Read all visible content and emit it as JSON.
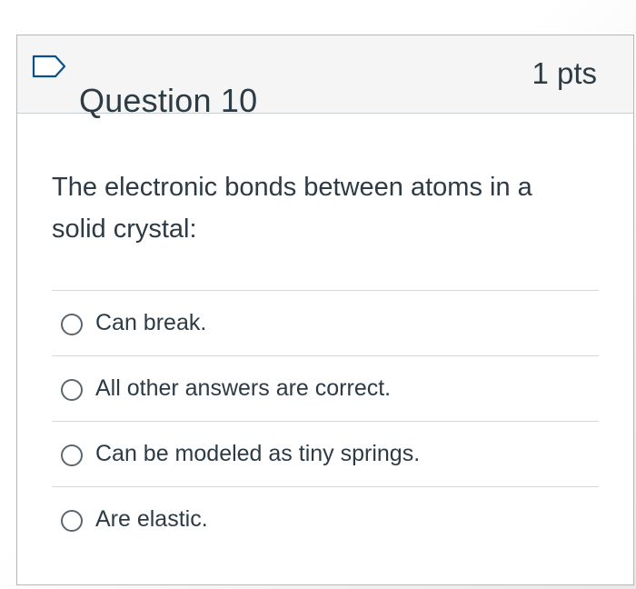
{
  "question": {
    "title": "Question 10",
    "points": "1 pts",
    "flag_icon": "flag-outline-icon",
    "text": "The electronic bonds between atoms in a solid crystal:",
    "answers": [
      {
        "label": "Can break."
      },
      {
        "label": "All other answers are correct."
      },
      {
        "label": "Can be modeled as tiny springs."
      },
      {
        "label": "Are elastic."
      }
    ],
    "selected_answer": null
  },
  "colors": {
    "text": "#2d3b45",
    "header_bg": "#f5f5f5",
    "border": "#b5b8bb",
    "flag_stroke": "#0b4f8a"
  }
}
